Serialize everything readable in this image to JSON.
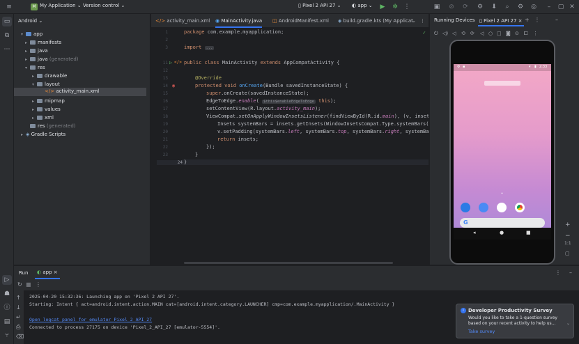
{
  "titlebar": {
    "project_initial": "M",
    "project_name": "My Application",
    "vcs": "Version control",
    "device": "Pixel 2 API 27",
    "run_config": "app"
  },
  "project_panel": {
    "view": "Android",
    "items": [
      {
        "label": "app",
        "level": 0
      },
      {
        "label": "manifests",
        "level": 1
      },
      {
        "label": "java",
        "level": 1
      },
      {
        "label": "java",
        "suffix": "(generated)",
        "level": 1
      },
      {
        "label": "res",
        "level": 1
      },
      {
        "label": "drawable",
        "level": 2
      },
      {
        "label": "layout",
        "level": 2
      },
      {
        "label": "activity_main.xml",
        "level": 3
      },
      {
        "label": "mipmap",
        "level": 2
      },
      {
        "label": "values",
        "level": 2
      },
      {
        "label": "xml",
        "level": 2
      },
      {
        "label": "res",
        "suffix": "(generated)",
        "level": 1
      },
      {
        "label": "Gradle Scripts",
        "level": 0
      }
    ]
  },
  "editor": {
    "tabs": [
      "activity_main.xml",
      "MainActivity.java",
      "AndroidManifest.xml",
      "build.gradle.kts (My Applicat"
    ],
    "active_tab": "MainActivity.java",
    "line_numbers": [
      "1",
      "2",
      "3",
      "11",
      "12",
      "13",
      "14",
      "15",
      "16",
      "17",
      "18",
      "19",
      "20",
      "21",
      "22",
      "23",
      "24"
    ],
    "code": {
      "l1_kw": "package",
      "l1_rest": " com.example.myapplication;",
      "l3_kw": "import",
      "l3_rest": "...",
      "l11_a": "public class ",
      "l11_b": "MainActivity ",
      "l11_c": "extends ",
      "l11_d": "AppCompatActivity {",
      "l13": "@Override",
      "l14_a": "protected void ",
      "l14_b": "onCreate",
      "l14_c": "(Bundle savedInstanceState) {",
      "l15_a": "super",
      "l15_b": ".onCreate(savedInstanceState);",
      "l16_a": "EdgeToEdge.",
      "l16_b": "enable",
      "l16_c": "( ",
      "l16_hint": "$this$enableEdgeToEdge",
      "l16_d": " this",
      "l16_e": ");",
      "l17_a": "setContentView(R.layout.",
      "l17_b": "activity_main",
      "l17_c": ");",
      "l18_a": "ViewCompat.",
      "l18_b": "setOnApplyWindowInsetsListener",
      "l18_c": "(findViewById(R.id.",
      "l18_d": "main",
      "l18_e": "), (v, insets) -",
      "l19": "Insets systemBars = insets.getInsets(WindowInsetsCompat.Type.systemBars());",
      "l20_a": "v.setPadding(systemBars.",
      "l20_b": "left",
      "l20_c": ", systemBars.",
      "l20_d": "top",
      "l20_e": ", systemBars.",
      "l20_f": "right",
      "l20_g": ", systemBars.bo",
      "l21_a": "return ",
      "l21_b": "insets;",
      "l22": "});",
      "l23": "}",
      "l24": "}"
    }
  },
  "devices": {
    "title": "Running Devices",
    "device_tab": "Pixel 2 API 27",
    "zoom_label": "1:1",
    "status_time": "2:33",
    "accent_colors": {
      "wallpaper_top": "#f3a8c6",
      "wallpaper_bottom": "#a88ad9",
      "phone_body": "#0c0c0c"
    }
  },
  "run_panel": {
    "tab_run": "Run",
    "tab_app": "app",
    "lines": [
      "2025-04-20 15:32:36: Launching app on 'Pixel 2 API 27'.",
      "Starting: Intent { act=android.intent.action.MAIN cat=[android.intent.category.LAUNCHER] cmp=com.example.myapplication/.MainActivity }",
      "Open logcat panel for emulator Pixel 2 API 27",
      "Connected to process 27175 on device 'Pixel_2_API_27 [emulator-5554]'."
    ]
  },
  "notification": {
    "title": "Developer Productivity Survey",
    "body1": "Would you like to take a 1-question survey",
    "body2": "based on your recent activity to help us...",
    "action": "Take survey"
  }
}
